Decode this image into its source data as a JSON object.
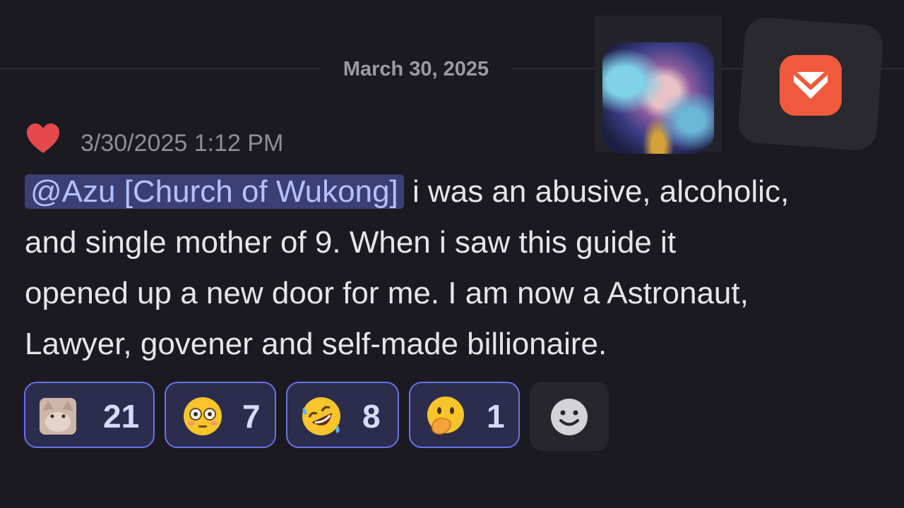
{
  "divider": {
    "date": "March 30, 2025"
  },
  "message": {
    "timestamp": "3/30/2025 1:12 PM",
    "mention": "@Azu [Church of Wukong]",
    "text_line1": " i was an abusive, alcoholic,",
    "text_line2": "and single mother of 9.  When i saw this guide it",
    "text_line3": "opened up a new door for me. I am now a Astronaut,",
    "text_line4": "Lawyer, govener and self-made billionaire."
  },
  "reactions": [
    {
      "emoji": "cat-face-emoji",
      "count": "21"
    },
    {
      "emoji": "flushed-face-emoji",
      "count": "7"
    },
    {
      "emoji": "rolling-laughing-emoji",
      "count": "8"
    },
    {
      "emoji": "hand-over-mouth-emoji",
      "count": "1"
    }
  ],
  "colors": {
    "background": "#1b1a21",
    "mention_bg": "#3b3f74",
    "mention_text": "#b4c1ff",
    "reaction_border": "#6b73e8",
    "heart": "#e5484d",
    "app_accent": "#f05a3c"
  }
}
